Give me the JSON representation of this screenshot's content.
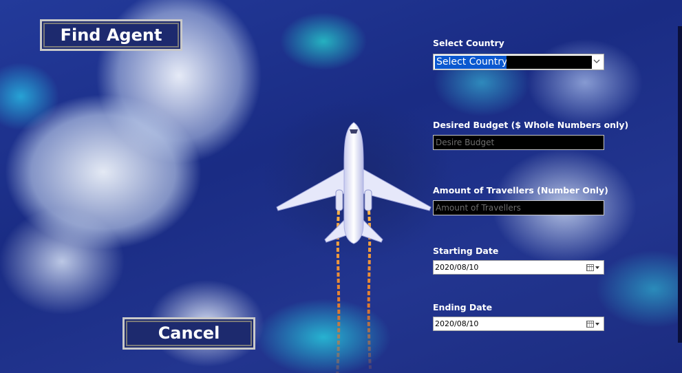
{
  "buttons": {
    "find_agent": "Find Agent",
    "cancel": "Cancel"
  },
  "form": {
    "country": {
      "label": "Select Country",
      "selected": "Select Country"
    },
    "budget": {
      "label": "Desired Budget ($ Whole Numbers only)",
      "placeholder": "Desire Budget",
      "value": ""
    },
    "travellers": {
      "label": "Amount of Travellers (Number Only)",
      "placeholder": "Amount of Travellers",
      "value": ""
    },
    "start_date": {
      "label": "Starting Date",
      "value": "2020/08/10"
    },
    "end_date": {
      "label": "Ending Date",
      "value": "2020/08/10"
    }
  },
  "icons": {
    "dropdown": "chevron-down-icon",
    "calendar": "calendar-icon"
  },
  "colors": {
    "button_bg": "#1d2a6e",
    "button_border": "#c9c9c9",
    "selection": "#0a58d0",
    "input_bg": "#000000"
  }
}
